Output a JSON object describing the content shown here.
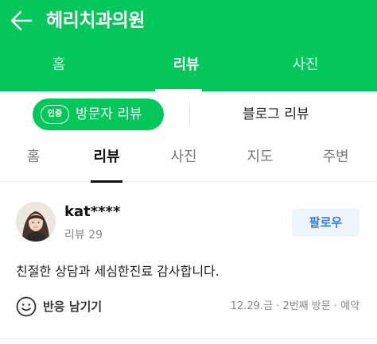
{
  "header": {
    "title": "헤리치과의원"
  },
  "top_tabs": [
    {
      "label": "홈",
      "active": false
    },
    {
      "label": "리뷰",
      "active": true
    },
    {
      "label": "사진",
      "active": false
    }
  ],
  "review_switch": {
    "badge": "인증",
    "visitor_label": "방문자 리뷰",
    "blog_label": "블로그 리뷰"
  },
  "sub_tabs": [
    {
      "label": "홈",
      "active": false
    },
    {
      "label": "리뷰",
      "active": true
    },
    {
      "label": "사진",
      "active": false
    },
    {
      "label": "지도",
      "active": false
    },
    {
      "label": "주변",
      "active": false
    }
  ],
  "review": {
    "nickname": "kat****",
    "review_count": "리뷰 29",
    "follow_label": "팔로우",
    "text": "친절한 상담과 세심한진료 감사합니다.",
    "reaction_label": "반응 남기기",
    "visit_info": "12.29.금 · 2번째 방문 · 예약"
  },
  "colors": {
    "brand_green": "#03c75a",
    "follow_blue": "#3a7cd6"
  },
  "icons": {
    "back": "arrow-left-icon",
    "reaction": "smile-icon"
  }
}
